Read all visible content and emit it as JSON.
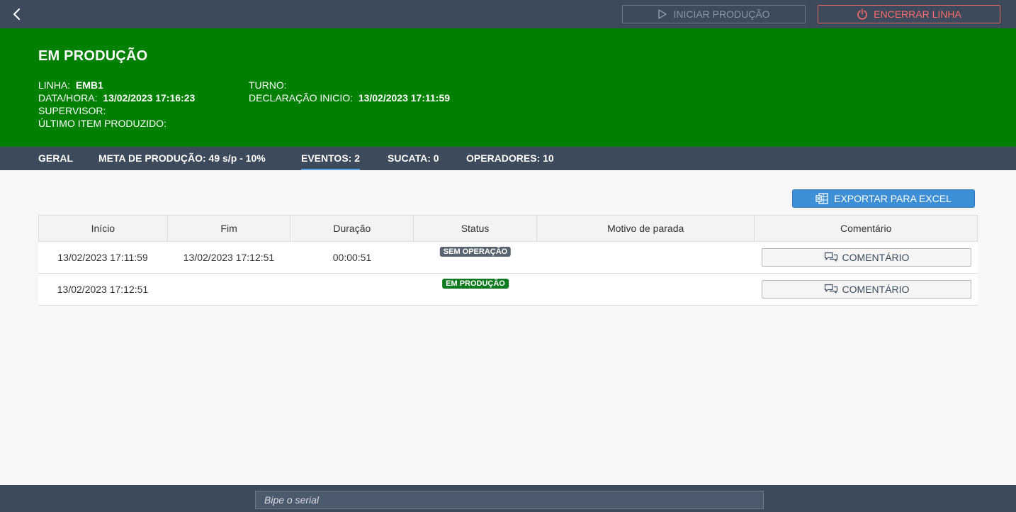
{
  "topbar": {
    "start_label": "INICIAR PRODUÇÃO",
    "end_label": "ENCERRAR LINHA"
  },
  "header": {
    "title": "EM PRODUÇÃO",
    "linha_label": "LINHA:",
    "linha_value": "EMB1",
    "datahora_label": "DATA/HORA:",
    "datahora_value": "13/02/2023 17:16:23",
    "supervisor_label": "SUPERVISOR:",
    "ultimo_label": "ÚLTIMO ITEM PRODUZIDO:",
    "turno_label": "TURNO:",
    "declaracao_label": "DECLARAÇÃO INICIO:",
    "declaracao_value": "13/02/2023 17:11:59"
  },
  "tabs": [
    {
      "label": "GERAL"
    },
    {
      "label": "META DE PRODUÇÃO: 49 s/p - 10%"
    },
    {
      "label": "EVENTOS: 2"
    },
    {
      "label": "SUCATA: 0"
    },
    {
      "label": "OPERADORES: 10"
    }
  ],
  "main": {
    "export_label": "EXPORTAR PARA EXCEL",
    "columns": [
      "Início",
      "Fim",
      "Duração",
      "Status",
      "Motivo de parada",
      "Comentário"
    ],
    "rows": [
      {
        "inicio": "13/02/2023 17:11:59",
        "fim": "13/02/2023 17:12:51",
        "duracao": "00:00:51",
        "status": "SEM OPERAÇÃO",
        "motivo": "",
        "comment_label": "COMENTÁRIO"
      },
      {
        "inicio": "13/02/2023 17:12:51",
        "fim": "",
        "duracao": "",
        "status": "EM PRODUÇÃO",
        "motivo": "",
        "comment_label": "COMENTÁRIO"
      }
    ]
  },
  "footer": {
    "serial_placeholder": "Bipe o serial"
  },
  "colors": {
    "header_green": "#008000",
    "bar_dark": "#3c4a5c",
    "export_blue": "#3d8fd6",
    "danger_red": "#ff6b6b",
    "status_gray": "#5a6470",
    "status_green": "#0d7a20"
  },
  "icons": {
    "back": "chevron-left-icon",
    "start": "play-icon",
    "end": "power-icon",
    "export": "excel-icon",
    "comment": "comment-icon"
  }
}
